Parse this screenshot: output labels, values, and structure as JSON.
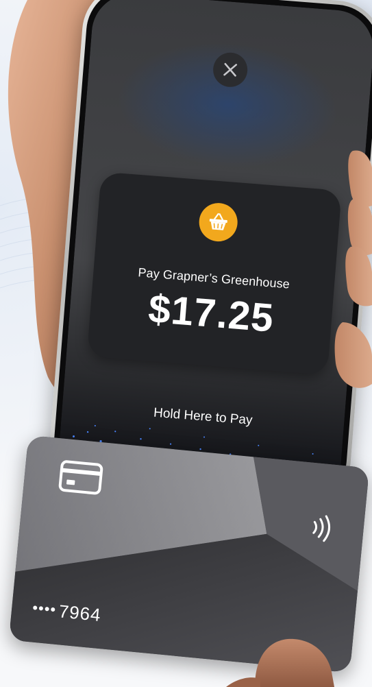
{
  "phone": {
    "close_icon": "close-icon",
    "merchant_icon": "shopping-basket-icon",
    "pay_label": "Pay Grapner’s Greenhouse",
    "amount": "$17.25",
    "hold_label": "Hold Here to Pay"
  },
  "card": {
    "card_icon": "credit-card-icon",
    "contactless_icon": "contactless-icon",
    "dots": "••••",
    "last4": "7964"
  },
  "colors": {
    "merchant_icon_bg": "#f2a81d",
    "pay_card_bg": "#222326",
    "screen_bg": "#404144",
    "card_bg": "#55555a"
  }
}
